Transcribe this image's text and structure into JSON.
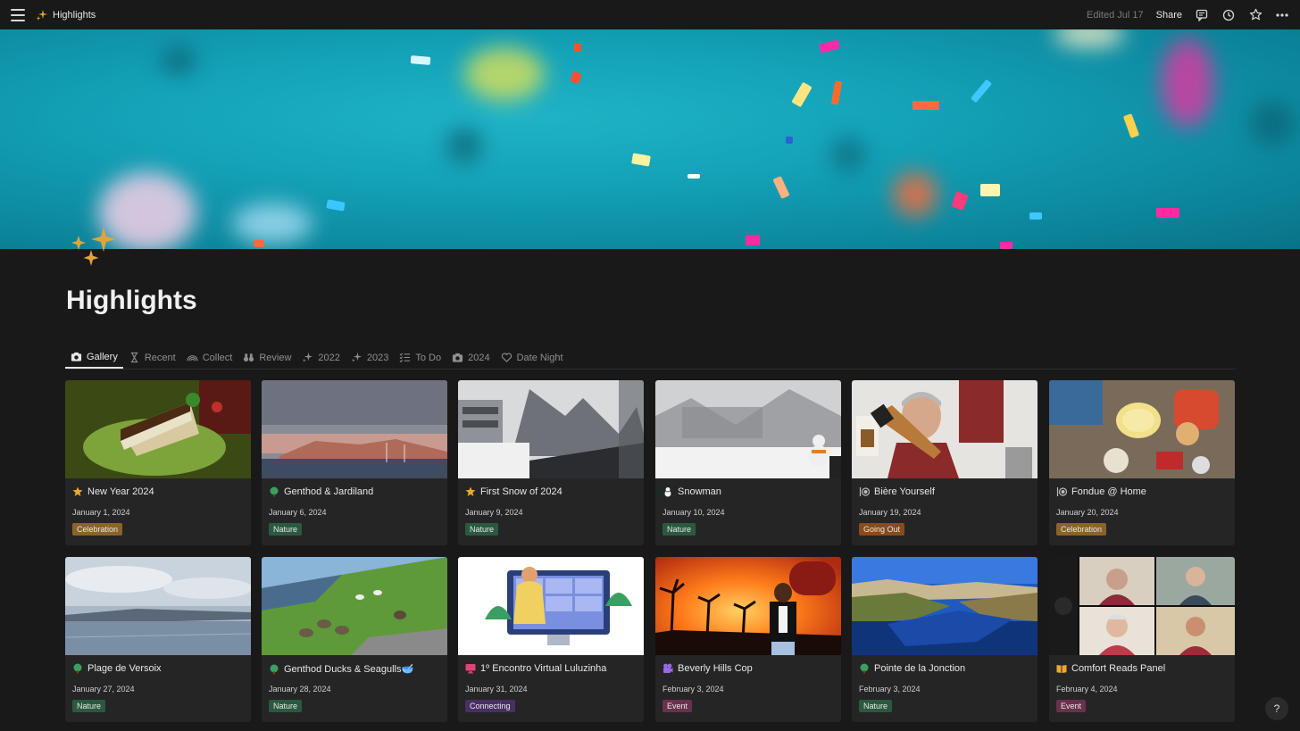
{
  "topbar": {
    "page_name": "Highlights",
    "edited": "Edited Jul 17",
    "share_label": "Share",
    "icons": [
      "comments-icon",
      "history-icon",
      "favorite-star-icon",
      "more-icon"
    ]
  },
  "page": {
    "title": "Highlights",
    "icon": "sparkles-icon"
  },
  "tabs": [
    {
      "label": "Gallery",
      "icon": "camera-icon",
      "active": true
    },
    {
      "label": "Recent",
      "icon": "hourglass-icon"
    },
    {
      "label": "Collect",
      "icon": "rainbow-icon"
    },
    {
      "label": "Review",
      "icon": "binoculars-icon"
    },
    {
      "label": "2022",
      "icon": "sparkle-icon"
    },
    {
      "label": "2023",
      "icon": "sparkle-icon"
    },
    {
      "label": "To Do",
      "icon": "checklist-icon"
    },
    {
      "label": "2024",
      "icon": "camera-icon"
    },
    {
      "label": "Date Night",
      "icon": "heart-icon"
    }
  ],
  "colors": {
    "background": "#191919",
    "card": "#252525",
    "tag_celebration": "#89632a",
    "tag_nature": "#2b593f",
    "tag_going_out": "#854c1d",
    "tag_connecting": "#492f64",
    "tag_event": "#69314c"
  },
  "cards": [
    {
      "title": "New Year 2024",
      "date": "January 1, 2024",
      "tag": "Celebration",
      "icon": "star-icon"
    },
    {
      "title": "Genthod & Jardiland",
      "date": "January 6, 2024",
      "tag": "Nature",
      "icon": "tree-icon"
    },
    {
      "title": "First Snow of 2024",
      "date": "January 9, 2024",
      "tag": "Nature",
      "icon": "star-icon"
    },
    {
      "title": "Snowman",
      "date": "January 10, 2024",
      "tag": "Nature",
      "icon": "snowman-icon"
    },
    {
      "title": "Bière Yourself",
      "date": "January 19, 2024",
      "tag": "Going Out",
      "icon": "dining-icon"
    },
    {
      "title": "Fondue @ Home",
      "date": "January 20, 2024",
      "tag": "Celebration",
      "icon": "dining-icon"
    },
    {
      "title": "Plage de Versoix",
      "date": "January 27, 2024",
      "tag": "Nature",
      "icon": "tree-icon"
    },
    {
      "title": "Genthod Ducks & Seagulls🥣",
      "date": "January 28, 2024",
      "tag": "Nature",
      "icon": "tree-icon"
    },
    {
      "title": "1º Encontro Virtual Luluzinha",
      "date": "January 31, 2024",
      "tag": "Connecting",
      "icon": "monitor-icon"
    },
    {
      "title": "Beverly Hills Cop",
      "date": "February 3, 2024",
      "tag": "Event",
      "icon": "film-camera-icon"
    },
    {
      "title": "Pointe de la Jonction",
      "date": "February 3, 2024",
      "tag": "Nature",
      "icon": "tree-icon"
    },
    {
      "title": "Comfort Reads Panel",
      "date": "February 4, 2024",
      "tag": "Event",
      "icon": "book-icon"
    }
  ],
  "help_label": "?"
}
